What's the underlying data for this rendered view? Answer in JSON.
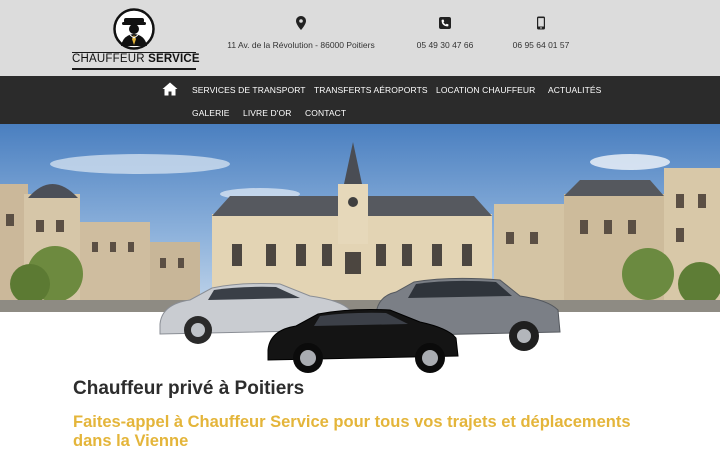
{
  "logo": {
    "text_light": "CHAUFFEUR",
    "text_bold": "SERVICE",
    "icon": "chauffeur-icon"
  },
  "contacts": {
    "address": {
      "icon": "map-pin-icon",
      "text": "11 Av. de la Révolution - 86000 Poitiers"
    },
    "phone": {
      "icon": "phone-icon",
      "text": "05 49 30 47 66"
    },
    "mobile": {
      "icon": "mobile-icon",
      "text": "06 95 64 01 57"
    }
  },
  "nav": {
    "home_icon": "home-icon",
    "items": [
      "SERVICES DE TRANSPORT",
      "TRANSFERTS AÉROPORTS",
      "LOCATION CHAUFFEUR",
      "ACTUALITÉS",
      "GALERIE",
      "LIVRE D'OR",
      "CONTACT"
    ]
  },
  "main": {
    "title": "Chauffeur privé à Poitiers",
    "subtitle": "Faites-appel à Chauffeur Service pour tous vos trajets et déplacements dans la Vienne"
  },
  "colors": {
    "topbar": "#dcdcdc",
    "navbar": "#2b2b2b",
    "accent": "#e4b53a",
    "heading": "#2d2d2d"
  }
}
